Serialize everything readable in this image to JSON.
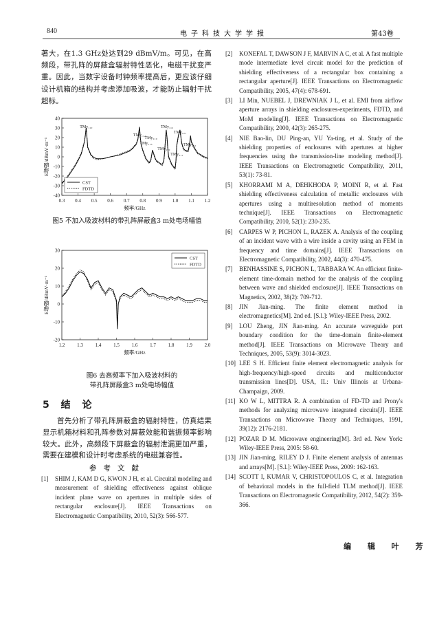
{
  "header": {
    "page_number": "840",
    "journal": "电子科技大学学报",
    "volume": "第43卷"
  },
  "intro_text": "著大，在1.3 GHz处达到29 dBmV/m。可见，在高频段，带孔阵的屏蔽盒辐射特性恶化，电磁干扰变严重。因此，当数字设备时钟频率提高后，更应该仔细设计机箱的结构并考虑添加吸波，才能防止辐射干扰超标。",
  "figures": {
    "fig5_caption": "图5  不加入吸波材料的带孔阵屏蔽盒3 m处电场幅值",
    "fig6_caption_line1": "图6  去高频率下加入吸波材料的",
    "fig6_caption_line2": "带孔阵屏蔽盒3 m处电场幅值"
  },
  "chart_data": [
    {
      "type": "line",
      "xlabel": "频率/GHz",
      "ylabel": "E场强/dBmV·m⁻¹",
      "xlim": [
        0.3,
        1.2
      ],
      "ylim": [
        -40,
        40
      ],
      "x_ticks": [
        "0.3",
        "0.4",
        "0.5",
        "0.6",
        "0.7",
        "0.8",
        "0.9",
        "1.0",
        "1.1",
        "1.2"
      ],
      "y_ticks": [
        "-40",
        "-30",
        "-20",
        "-10",
        "0",
        "10",
        "20",
        "30",
        "40"
      ],
      "legend": [
        "CST",
        "FDTD"
      ],
      "legend_position": "bottom-left",
      "annotations": [
        {
          "label": "TMy₁₁₀",
          "x": 0.45
        },
        {
          "label": "TMy₁₁₁",
          "x": 0.78
        },
        {
          "label": "TMy₁₁₂",
          "x": 0.95
        },
        {
          "label": "TMy₁₁₃",
          "x": 0.82
        },
        {
          "label": "TMy₁₂₁",
          "x": 1.03
        },
        {
          "label": "TMy₂₁₀",
          "x": 0.85
        },
        {
          "label": "TMy₁₂₀",
          "x": 0.93
        },
        {
          "label": "TMy₂₁₁",
          "x": 1.01
        },
        {
          "label": "TMy₂₁₂",
          "x": 1.09
        }
      ],
      "series": [
        {
          "name": "CST",
          "x": [
            0.3,
            0.32,
            0.34,
            0.36,
            0.38,
            0.4,
            0.42,
            0.43,
            0.44,
            0.445,
            0.45,
            0.455,
            0.46,
            0.48,
            0.5,
            0.52,
            0.55,
            0.58,
            0.6,
            0.63,
            0.66,
            0.69,
            0.72,
            0.74,
            0.76,
            0.77,
            0.775,
            0.78,
            0.785,
            0.79,
            0.8,
            0.82,
            0.84,
            0.85,
            0.855,
            0.86,
            0.87,
            0.88,
            0.9,
            0.92,
            0.93,
            0.935,
            0.94,
            0.945,
            0.95,
            0.955,
            0.96,
            0.98,
            1.0,
            1.005,
            1.01,
            1.02,
            1.03,
            1.04,
            1.05,
            1.06,
            1.08,
            1.09,
            1.095,
            1.1,
            1.12,
            1.14,
            1.16,
            1.18,
            1.2
          ],
          "y": [
            -28,
            -24,
            -20,
            -15,
            -10,
            -4,
            3,
            9,
            16,
            22,
            30,
            21,
            10,
            2,
            -1,
            -2,
            -2,
            -1,
            0,
            1,
            2,
            4,
            6,
            9,
            13,
            18,
            25,
            31,
            20,
            13,
            7,
            -2,
            -6,
            -3,
            2,
            7,
            2,
            -3,
            -6,
            -8,
            -4,
            5,
            18,
            28,
            20,
            8,
            0,
            -8,
            -12,
            -4,
            12,
            22,
            28,
            15,
            9,
            7,
            6,
            14,
            22,
            16,
            9,
            4,
            2,
            0,
            -1
          ]
        },
        {
          "name": "FDTD",
          "x": [
            0.3,
            0.32,
            0.34,
            0.36,
            0.38,
            0.4,
            0.42,
            0.43,
            0.44,
            0.445,
            0.45,
            0.455,
            0.46,
            0.48,
            0.5,
            0.52,
            0.55,
            0.58,
            0.6,
            0.63,
            0.66,
            0.69,
            0.72,
            0.74,
            0.76,
            0.77,
            0.775,
            0.78,
            0.785,
            0.79,
            0.8,
            0.82,
            0.84,
            0.85,
            0.855,
            0.86,
            0.87,
            0.88,
            0.9,
            0.92,
            0.93,
            0.935,
            0.94,
            0.945,
            0.95,
            0.955,
            0.96,
            0.98,
            1.0,
            1.005,
            1.01,
            1.02,
            1.03,
            1.04,
            1.05,
            1.06,
            1.08,
            1.09,
            1.095,
            1.1,
            1.12,
            1.14,
            1.16,
            1.18,
            1.2
          ],
          "y": [
            -27,
            -23,
            -19,
            -14,
            -9,
            -3,
            4,
            10,
            17,
            23,
            29,
            20,
            9,
            1,
            -2,
            -3,
            -2,
            -1,
            0,
            1,
            3,
            5,
            7,
            10,
            14,
            19,
            24,
            30,
            19,
            12,
            6,
            -3,
            -7,
            -4,
            1,
            6,
            1,
            -4,
            -7,
            -9,
            -5,
            4,
            17,
            27,
            19,
            7,
            -1,
            -9,
            -13,
            -5,
            11,
            21,
            27,
            14,
            8,
            6,
            5,
            13,
            21,
            15,
            8,
            3,
            1,
            -1,
            -2
          ]
        }
      ]
    },
    {
      "type": "line",
      "xlabel": "频率/GHz",
      "ylabel": "E场强/dBmV·m⁻¹",
      "xlim": [
        1.2,
        2.0
      ],
      "ylim": [
        -20,
        30
      ],
      "x_ticks": [
        "1.2",
        "1.3",
        "1.4",
        "1.5",
        "1.6",
        "1.7",
        "1.8",
        "1.9",
        "2.0"
      ],
      "y_ticks": [
        "-20",
        "-10",
        "0",
        "10",
        "20",
        "30"
      ],
      "legend": [
        "CST",
        "FDTD"
      ],
      "legend_position": "top-right",
      "series": [
        {
          "name": "CST",
          "x": [
            1.2,
            1.22,
            1.24,
            1.26,
            1.28,
            1.3,
            1.32,
            1.34,
            1.36,
            1.38,
            1.4,
            1.42,
            1.44,
            1.46,
            1.48,
            1.5,
            1.505,
            1.51,
            1.52,
            1.54,
            1.56,
            1.58,
            1.6,
            1.62,
            1.64,
            1.66,
            1.68,
            1.7,
            1.72,
            1.74,
            1.76,
            1.78,
            1.8,
            1.82,
            1.84,
            1.86,
            1.88,
            1.9,
            1.92,
            1.94,
            1.96,
            1.98,
            2.0
          ],
          "y": [
            4,
            6,
            9,
            13,
            16,
            18,
            17,
            14,
            9,
            12,
            13,
            9,
            6,
            9,
            8,
            2,
            -14,
            0,
            4,
            6,
            5,
            4,
            6,
            8,
            9,
            7,
            5,
            6,
            5,
            4,
            4,
            3,
            4,
            3,
            4,
            3,
            2,
            2,
            2,
            3,
            3,
            2,
            2
          ]
        },
        {
          "name": "FDTD",
          "x": [
            1.2,
            1.22,
            1.24,
            1.26,
            1.28,
            1.3,
            1.32,
            1.34,
            1.36,
            1.38,
            1.4,
            1.42,
            1.44,
            1.46,
            1.48,
            1.5,
            1.505,
            1.51,
            1.52,
            1.54,
            1.56,
            1.58,
            1.6,
            1.62,
            1.64,
            1.66,
            1.68,
            1.7,
            1.72,
            1.74,
            1.76,
            1.78,
            1.8,
            1.82,
            1.84,
            1.86,
            1.88,
            1.9,
            1.92,
            1.94,
            1.96,
            1.98,
            2.0
          ],
          "y": [
            4,
            7,
            10,
            14,
            17,
            19,
            18,
            13,
            8,
            11,
            12,
            8,
            5,
            8,
            7,
            1,
            -12,
            0,
            3,
            5,
            4,
            3,
            5,
            7,
            8,
            6,
            4,
            5,
            4,
            3,
            3,
            2,
            3,
            2,
            3,
            2,
            1,
            1,
            1,
            2,
            2,
            1,
            1
          ]
        }
      ]
    }
  ],
  "conclusion": {
    "title": "5  结  论",
    "text": "首先分析了带孔阵屏蔽盒的辐射特性，仿真结果显示机箱材料和孔阵参数对屏蔽效能和谐振频率影响较大。此外，高频段下屏蔽盒的辐射泄漏更加严重，需要在建模和设计时考虑系统的电磁兼容性。"
  },
  "references_title": "参考文献",
  "references_left": [
    {
      "num": "[1]",
      "text": "SHIM J, KAM D G, KWON J H, et al. Circuital modeling and measurement of shielding effectiveness against oblique incident plane wave on apertures in multiple sides of rectangular enclosure[J]. IEEE Transactions on Electromagnetic Compatibility, 2010, 52(3): 566-577."
    }
  ],
  "references_right": [
    {
      "num": "[2]",
      "text": "KONEFAL T, DAWSON J F, MARVIN A C, et al. A fast multiple mode intermediate level circuit model for the prediction of shielding effectiveness of a rectangular box containing a rectangular aperture[J]. IEEE Transactions on Electromagnetic Compatibility, 2005, 47(4): 678-691."
    },
    {
      "num": "[3]",
      "text": "LI Min, NUEBEL J, DREWNIAK J L, et al. EMI from airflow aperture arrays in shielding enclosures-experiments, FDTD, and MoM modeling[J]. IEEE Transactions on Electromagnetic Compatibility, 2000, 42(3): 265-275."
    },
    {
      "num": "[4]",
      "text": "NIE Bao-lin, DU Ping-an, YU Ya-ting, et al. Study of the shielding properties of enclosures with apertures at higher frequencies using the transmission-line modeling method[J]. IEEE Transactions on Electromagnetic Compatibility, 2011, 53(1): 73-81."
    },
    {
      "num": "[5]",
      "text": "KHORRAMI M A, DEHKHODA P, MOINI R, et al. Fast shielding effectiveness calculation of metallic enclosures with apertures using a multiresolution method of moments technique[J]. IEEE Transactions on Electromagnetic Compatibility, 2010, 52(1): 230-235."
    },
    {
      "num": "[6]",
      "text": "CARPES W P, PICHON L, RAZEK A. Analysis of the coupling of an incident wave with a wire inside a cavity using an FEM in frequency and time domains[J]. IEEE Transactions on Electromagnetic Compatibility, 2002, 44(3): 470-475."
    },
    {
      "num": "[7]",
      "text": "BENHASSINE S, PICHON L, TABBARA W. An efficient finite-element time-domain method for the analysis of the coupling between wave and shielded enclosure[J]. IEEE Transactions on Magnetics, 2002, 38(2): 709-712."
    },
    {
      "num": "[8]",
      "text": "JIN Jian-ming. The finite element method in electromagnetics[M]. 2nd ed. [S.l.]: Wiley-IEEE Press, 2002."
    },
    {
      "num": "[9]",
      "text": "LOU Zheng, JIN Jian-ming. An accurate waveguide port boundary condition for the time-domain finite-element method[J]. IEEE Transactions on Microwave Theory and Techniques, 2005, 53(9): 3014-3023."
    },
    {
      "num": "[10]",
      "text": "LEE S H. Efficient finite element electromagnetic analysis for high-frequency/high-speed circuits and multiconductor transmission lines[D]. USA, IL: Univ Illinois at Urbana-Champaign, 2009."
    },
    {
      "num": "[11]",
      "text": "KO W L, MITTRA R. A combination of FD-TD and Prony's methods for analyzing microwave integrated circuits[J]. IEEE Transactions on Microwave Theory and Techniques, 1991, 39(12): 2176-2181."
    },
    {
      "num": "[12]",
      "text": "POZAR D M. Microwave engineering[M]. 3rd ed. New York: Wiley-IEEE Press, 2005: 58-60."
    },
    {
      "num": "[13]",
      "text": "JIN Jian-ming, RILEY D J. Finite element analysis of antennas and arrays[M]. [S.l.]: Wiley-IEEE Press, 2009: 162-163."
    },
    {
      "num": "[14]",
      "text": "SCOTT I, KUMAR V, CHRISTOPOULOS C, et al. Integration of behavioral models in the full-field TLM method[J]. IEEE Transactions on Electromagnetic Compatibility, 2012, 54(2): 359-366."
    }
  ],
  "editor": "编 辑 叶 芳"
}
